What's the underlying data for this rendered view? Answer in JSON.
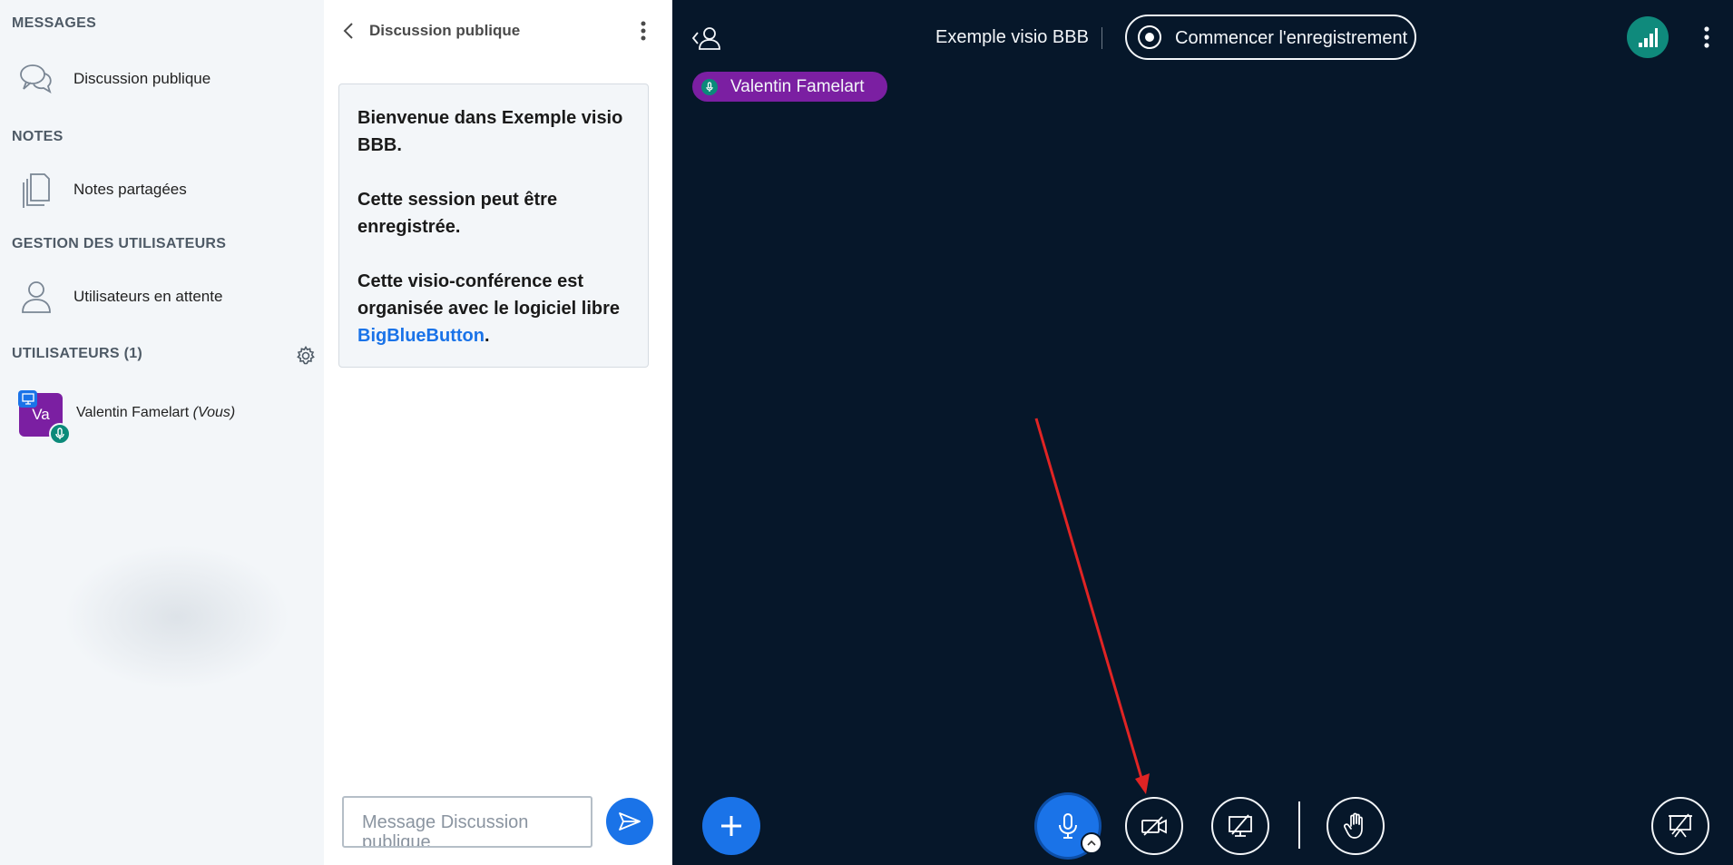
{
  "sidebar": {
    "messages_title": "MESSAGES",
    "public_chat_label": "Discussion publique",
    "notes_title": "NOTES",
    "shared_notes_label": "Notes partagées",
    "user_mgmt_title": "GESTION DES UTILISATEURS",
    "waiting_users_label": "Utilisateurs en attente",
    "users_title": "UTILISATEURS (1)",
    "user": {
      "initials": "Va",
      "name": "Valentin Famelart",
      "you_suffix": "(Vous)"
    }
  },
  "chat": {
    "title": "Discussion publique",
    "welcome_line1": "Bienvenue dans Exemple visio BBB.",
    "welcome_line2": "Cette session peut être enregistrée.",
    "welcome_line3": "Cette visio-conférence est organisée avec le logiciel libre",
    "welcome_link": "BigBlueButton",
    "welcome_end": ".",
    "input_placeholder": "Message Discussion publique"
  },
  "main": {
    "meeting_title": "Exemple visio BBB",
    "record_label": "Commencer l'enregistrement",
    "talker_name": "Valentin Famelart"
  },
  "icons": {
    "chat": "chat-bubbles-icon",
    "notes": "document-icon",
    "waiting": "user-icon",
    "settings": "gear-icon",
    "send": "send-icon",
    "plus": "plus-icon",
    "mic": "microphone-icon",
    "camera": "camera-off-icon",
    "screenshare": "screenshare-off-icon",
    "hand": "raise-hand-icon",
    "presentation": "presentation-icon"
  },
  "colors": {
    "primary": "#1a73e8",
    "main_bg": "#06172a",
    "sidebar_bg": "#f3f6f9",
    "avatar": "#7b1fa2",
    "connection": "#0f8a7c",
    "annotation_arrow": "#e02424"
  }
}
